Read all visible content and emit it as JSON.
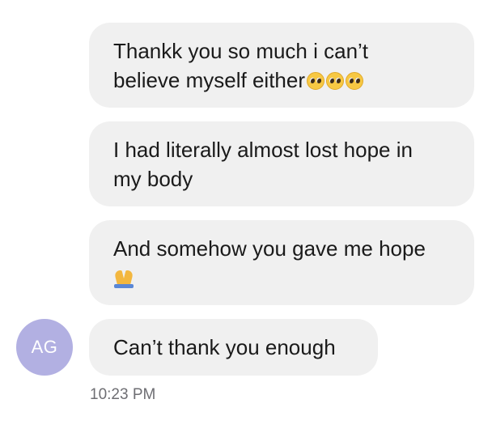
{
  "conversation": {
    "messages": [
      {
        "line1": "Thankk you so much i can’t",
        "line2": "believe myself either",
        "emoji": "pleading-face-emoji"
      },
      {
        "line1": "I had literally almost lost hope in",
        "line2": "my body"
      },
      {
        "line1": "And somehow you gave me hope",
        "emoji": "folded-hands-emoji"
      },
      {
        "line1": "Can’t thank you enough"
      }
    ],
    "sender": {
      "initials": "AG",
      "avatar_color": "#b2b0e2"
    },
    "timestamp": "10:23 PM"
  },
  "colors": {
    "bubble_background": "#f0f0f0",
    "text": "#1a1a1a",
    "timestamp": "#6e6e73"
  }
}
